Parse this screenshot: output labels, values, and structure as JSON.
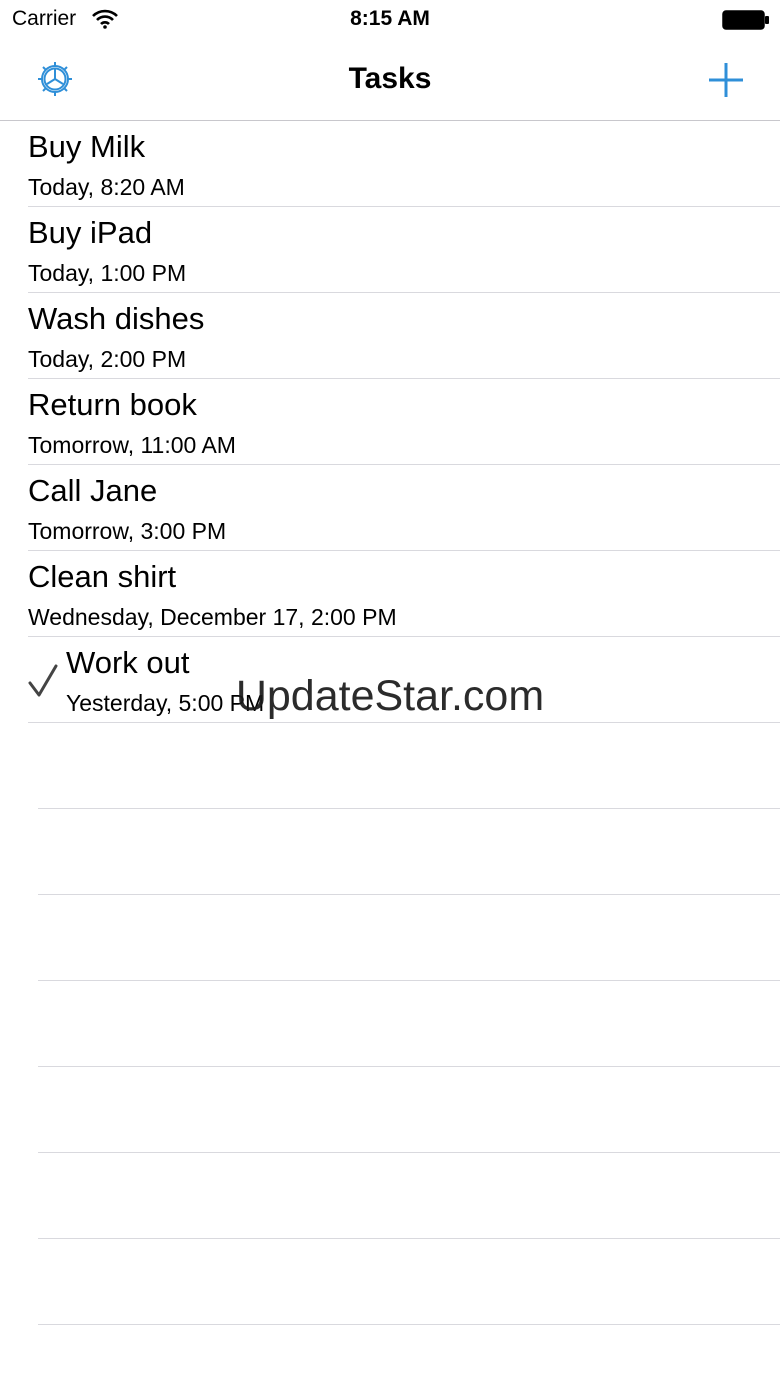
{
  "status_bar": {
    "carrier": "Carrier",
    "time": "8:15 AM",
    "wifi_icon": "wifi-icon",
    "battery_icon": "battery-icon"
  },
  "nav": {
    "title": "Tasks",
    "left_icon": "gear-icon",
    "right_icon": "plus-icon",
    "accent_color": "#2f8fd8"
  },
  "tasks": [
    {
      "title": "Buy Milk",
      "time": "Today, 8:20 AM",
      "done": false
    },
    {
      "title": "Buy iPad",
      "time": "Today, 1:00 PM",
      "done": false
    },
    {
      "title": "Wash dishes",
      "time": "Today, 2:00 PM",
      "done": false
    },
    {
      "title": "Return book",
      "time": "Tomorrow, 11:00 AM",
      "done": false
    },
    {
      "title": "Call Jane",
      "time": "Tomorrow, 3:00 PM",
      "done": false
    },
    {
      "title": "Clean shirt",
      "time": "Wednesday, December 17, 2:00 PM",
      "done": false
    },
    {
      "title": "Work out",
      "time": "Yesterday, 5:00 PM",
      "done": true
    }
  ],
  "watermark": "UpdateStar.com"
}
